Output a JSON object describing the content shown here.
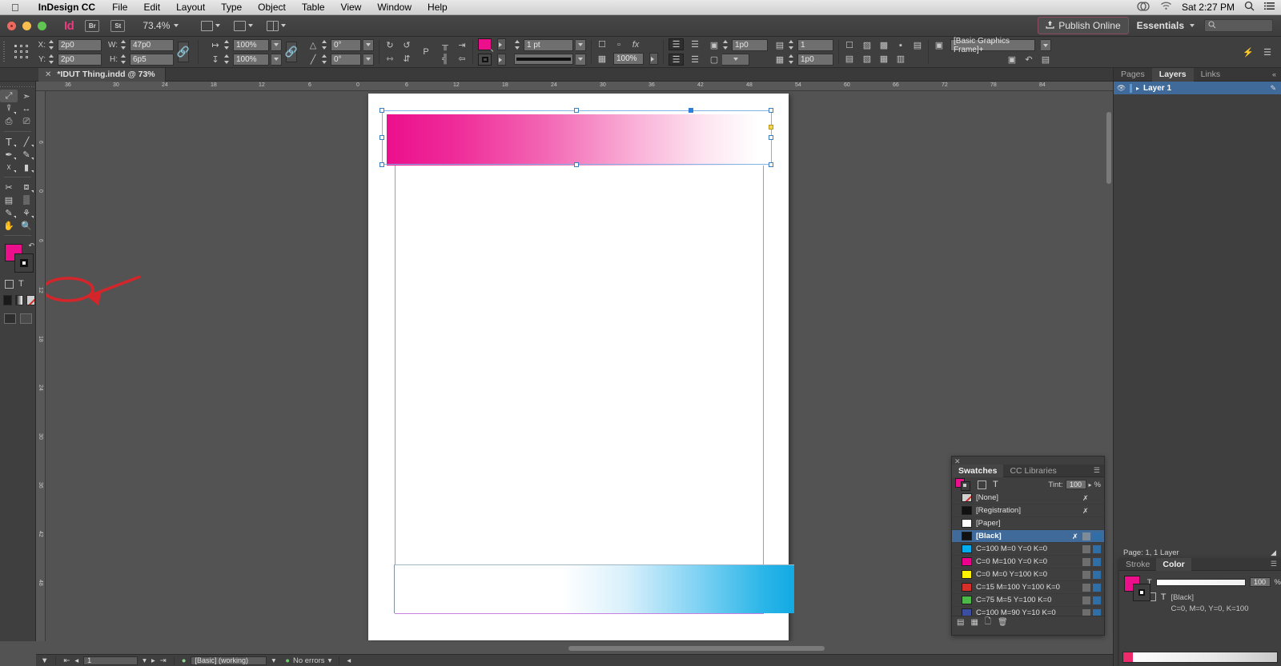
{
  "macbar": {
    "apple_icon": "apple-icon",
    "app_name": "InDesign CC",
    "menus": [
      "File",
      "Edit",
      "Layout",
      "Type",
      "Object",
      "Table",
      "View",
      "Window",
      "Help"
    ],
    "cc_icon": "creative-cloud-icon",
    "wifi_icon": "wifi-icon",
    "clock": "Sat 2:27 PM",
    "search_icon": "spotlight-search-icon",
    "list_icon": "notification-center-icon"
  },
  "appbar": {
    "logo": "Id",
    "bridge_label": "Br",
    "stock_label": "St",
    "zoom_level": "73.4%",
    "screen_mode_icon": "screen-mode-icon",
    "view_options_icon": "view-options-icon",
    "arrange_docs_icon": "arrange-documents-icon",
    "publish_online": "Publish Online",
    "publish_icon": "publish-upload-icon",
    "workspace": "Essentials",
    "search_placeholder": ""
  },
  "controlbar": {
    "reference_point_icon": "reference-point-proxy",
    "x_label": "X:",
    "x_value": "2p0",
    "y_label": "Y:",
    "y_value": "2p0",
    "w_label": "W:",
    "w_value": "47p0",
    "h_label": "H:",
    "h_value": "6p5",
    "scale_x": "100%",
    "scale_y": "100%",
    "rotation": "0°",
    "shear": "0°",
    "constrain_icon": "chain-link-icon",
    "rotate_cw_icon": "rotate-clockwise-icon",
    "rotate_ccw_icon": "rotate-counterclockwise-icon",
    "flip_h_icon": "flip-horizontal-icon",
    "flip_v_icon": "flip-vertical-icon",
    "fill_color": "#ec0f8c",
    "stroke_color": "#111111",
    "stroke_weight": "1 pt",
    "stroke_style": "solid-line",
    "effects_icon": "fx-effects-icon",
    "opacity": "100%",
    "text_wrap_icon": "text-wrap-icon",
    "frame_fitting_icon": "frame-fitting-icon",
    "corner_radius": "1p0",
    "columns": "1",
    "gutter": "1p0",
    "object_style": "[Basic Graphics Frame]+",
    "select_content_icon": "select-content-icon"
  },
  "doctab": {
    "close_icon": "close-tab-icon",
    "title": "*IDUT Thing.indd @ 73%"
  },
  "toolbar": {
    "tools": [
      {
        "name": "selection-tool",
        "glyph": "↖",
        "selected": true
      },
      {
        "name": "direct-selection-tool",
        "glyph": "➤",
        "selected": false
      },
      {
        "name": "page-tool",
        "glyph": "❐",
        "selected": false
      },
      {
        "name": "gap-tool",
        "glyph": "↔",
        "selected": false
      },
      {
        "name": "content-collector-tool",
        "glyph": "⊞",
        "selected": false
      },
      {
        "name": "content-placer-tool",
        "glyph": "⊟",
        "selected": false
      },
      {
        "name": "type-tool",
        "glyph": "T",
        "selected": false
      },
      {
        "name": "line-tool",
        "glyph": "╱",
        "selected": false
      },
      {
        "name": "pen-tool",
        "glyph": "✒",
        "selected": false
      },
      {
        "name": "pencil-tool",
        "glyph": "✎",
        "selected": false
      },
      {
        "name": "frame-tool",
        "glyph": "⌧",
        "selected": false
      },
      {
        "name": "rectangle-tool",
        "glyph": "▭",
        "selected": false
      },
      {
        "name": "scissors-tool",
        "glyph": "✂",
        "selected": false
      },
      {
        "name": "free-transform-tool",
        "glyph": "⬚",
        "selected": false
      },
      {
        "name": "gradient-swatch-tool",
        "glyph": "▤",
        "selected": false
      },
      {
        "name": "gradient-feather-tool",
        "glyph": "▒",
        "selected": false
      },
      {
        "name": "note-tool",
        "glyph": "✐",
        "selected": false
      },
      {
        "name": "eyedropper-tool",
        "glyph": "↗",
        "selected": false
      },
      {
        "name": "hand-tool",
        "glyph": "✋",
        "selected": false
      },
      {
        "name": "zoom-tool",
        "glyph": "⚲",
        "selected": false
      }
    ],
    "fill_color": "#ec0f8c",
    "stroke_color": "#111111",
    "annotation": "red-ellipse-annotation-on-gradient-tools"
  },
  "canvas": {
    "page_label": "document-page",
    "top_object": {
      "name": "magenta-gradient-frame",
      "gradient_from": "#ec0f8c",
      "gradient_to": "#ffffff",
      "selected": true
    },
    "bottom_object": {
      "name": "cyan-gradient-frame",
      "gradient_from": "#ffffff",
      "gradient_to": "#12a9e3",
      "selected": false
    },
    "margin_color": "#c77fe0",
    "h_ruler_ticks": [
      "36",
      "30",
      "24",
      "18",
      "12",
      "6",
      "0",
      "6",
      "12",
      "18",
      "24",
      "30",
      "36",
      "42",
      "48",
      "54",
      "60",
      "66",
      "72",
      "78",
      "84"
    ],
    "v_ruler_ticks": [
      "6",
      "0",
      "6",
      "12",
      "18",
      "24",
      "30",
      "36",
      "42",
      "48"
    ]
  },
  "dock": {
    "panel_tabs": [
      "Pages",
      "Layers",
      "Links"
    ],
    "active_tab": "Layers",
    "collapse_icon": "collapse-dock-icon",
    "layer": {
      "eye_icon": "visibility-eye-icon",
      "name": "Layer 1",
      "pencil_icon": "edit-pencil-icon",
      "disclosure_icon": "chevron-right-icon"
    }
  },
  "swatches": {
    "close_icon": "close-panel-icon",
    "tabs": [
      "Swatches",
      "CC Libraries"
    ],
    "active_tab": "Swatches",
    "menu_icon": "panel-menu-icon",
    "fill_color": "#ec0f8c",
    "tint_label": "Tint:",
    "tint_value": "100",
    "tint_unit": "%",
    "formatting_fill_icon": "formatting-affects-fill-icon",
    "formatting_text_icon": "formatting-affects-text-icon",
    "items": [
      {
        "name": "[None]",
        "color": "none",
        "selected": false
      },
      {
        "name": "[Registration]",
        "color": "#111111",
        "selected": false
      },
      {
        "name": "[Paper]",
        "color": "#ffffff",
        "selected": false
      },
      {
        "name": "[Black]",
        "color": "#111111",
        "selected": true
      },
      {
        "name": "C=100 M=0 Y=0 K=0",
        "color": "#00aeef",
        "selected": false
      },
      {
        "name": "C=0 M=100 Y=0 K=0",
        "color": "#ec008c",
        "selected": false
      },
      {
        "name": "C=0 M=0 Y=100 K=0",
        "color": "#fff200",
        "selected": false
      },
      {
        "name": "C=15 M=100 Y=100 K=0",
        "color": "#d42f28",
        "selected": false
      },
      {
        "name": "C=75 M=5 Y=100 K=0",
        "color": "#4cb848",
        "selected": false
      },
      {
        "name": "C=100 M=90 Y=10 K=0",
        "color": "#3b4ea0",
        "selected": false
      }
    ],
    "footer_icons": [
      "show-all-swatches-icon",
      "new-color-group-icon",
      "new-swatch-icon",
      "delete-swatch-icon"
    ]
  },
  "color_panel": {
    "page_status": "Page: 1, 1 Layer",
    "tabs": [
      "Stroke",
      "Color"
    ],
    "active_tab": "Color",
    "fill_color": "#ec0f8c",
    "tint_letter": "T",
    "tint_value": "100",
    "tint_unit": "%",
    "swatch_name": "[Black]",
    "swatch_values": "C=0, M=0, Y=0, K=100",
    "spectrum_icon": "color-spectrum-ramp"
  },
  "statusbar": {
    "page_number": "1",
    "preflight_profile": "[Basic] (working)",
    "errors": "No errors",
    "first_page_icon": "first-page-icon",
    "prev_page_icon": "previous-page-icon",
    "next_page_icon": "next-page-icon",
    "last_page_icon": "last-page-icon"
  }
}
